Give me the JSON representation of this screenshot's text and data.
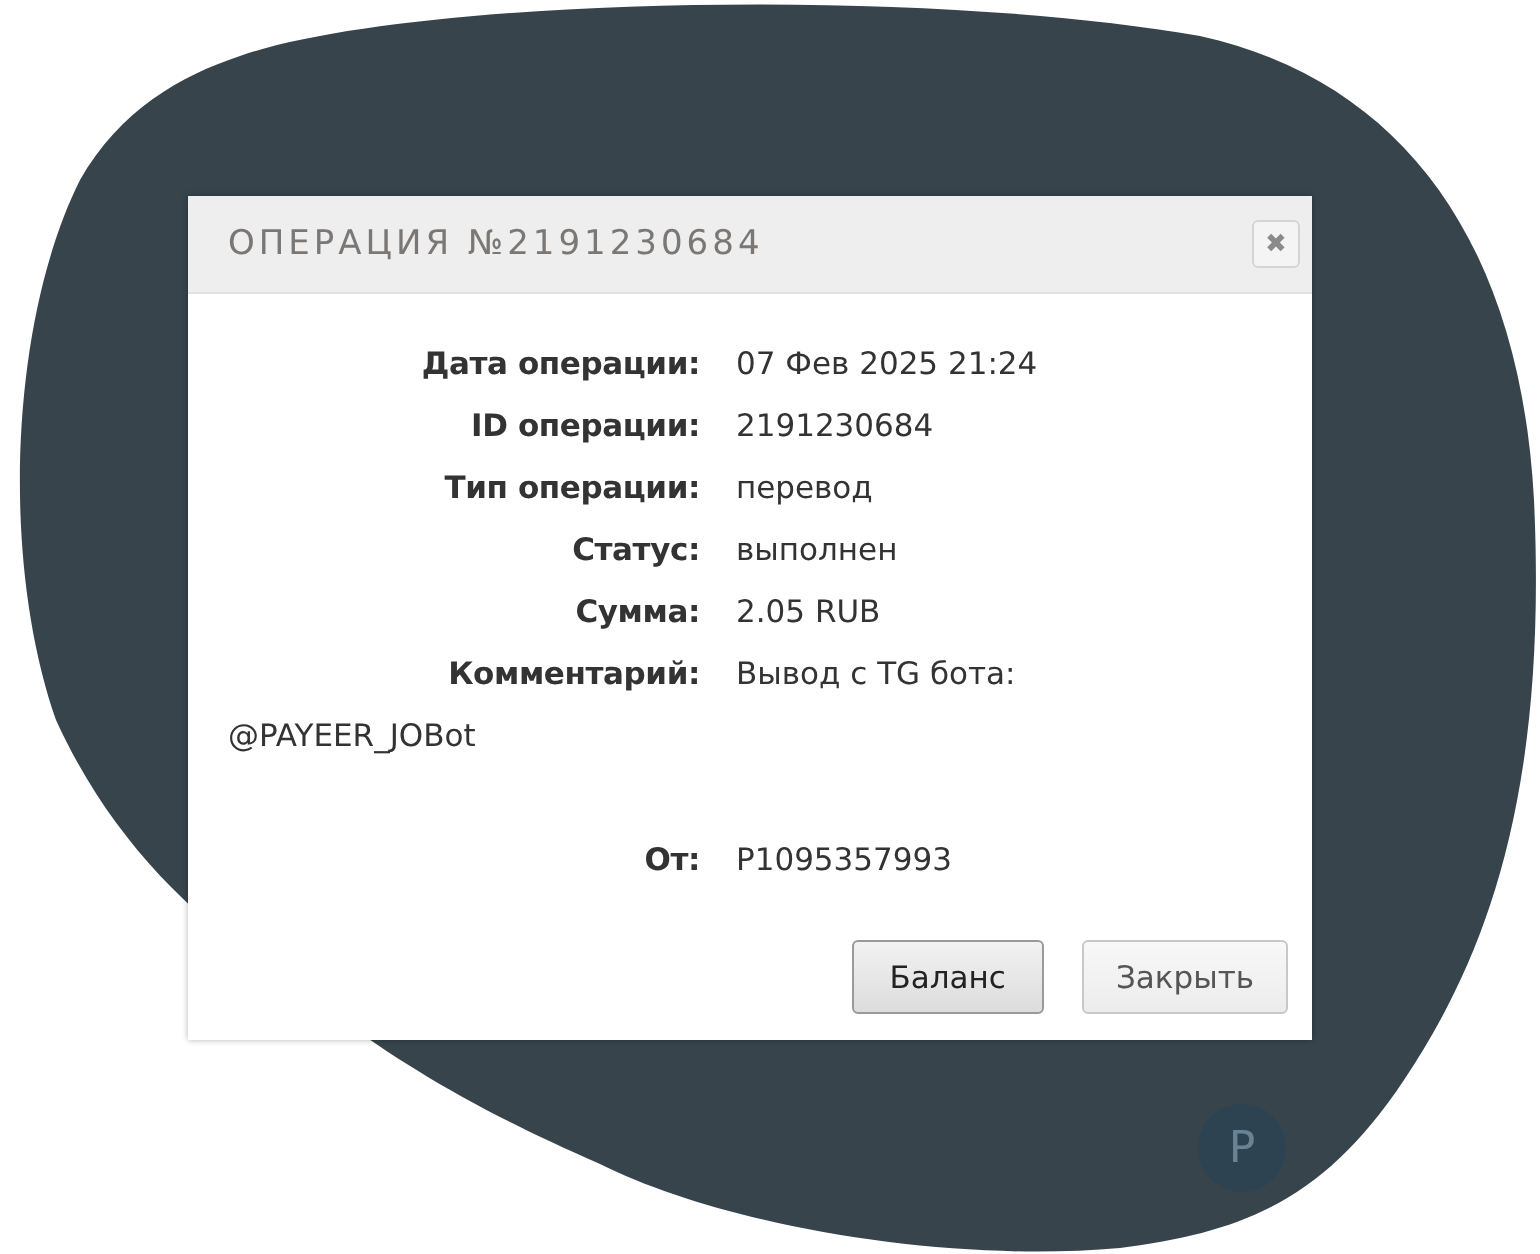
{
  "dialog": {
    "title": "ОПЕРАЦИЯ №2191230684",
    "close_icon": "✖",
    "details": [
      {
        "label": "Дата операции:",
        "value": "07 Фев 2025 21:24"
      },
      {
        "label": "ID операции:",
        "value": "2191230684"
      },
      {
        "label": "Тип операции:",
        "value": "перевод"
      },
      {
        "label": "Статус:",
        "value": "выполнен"
      },
      {
        "label": "Сумма:",
        "value": "2.05 RUB"
      },
      {
        "label": "Комментарий:",
        "value": "Вывод с TG бота:",
        "continuation": "@PAYEER_JOBot"
      },
      {
        "label": "От:",
        "value": "P1095357993"
      }
    ],
    "buttons": [
      {
        "label": "Баланс",
        "highlighted": true
      },
      {
        "label": "Закрыть",
        "highlighted": false
      }
    ]
  },
  "logo": {
    "text": "P"
  }
}
